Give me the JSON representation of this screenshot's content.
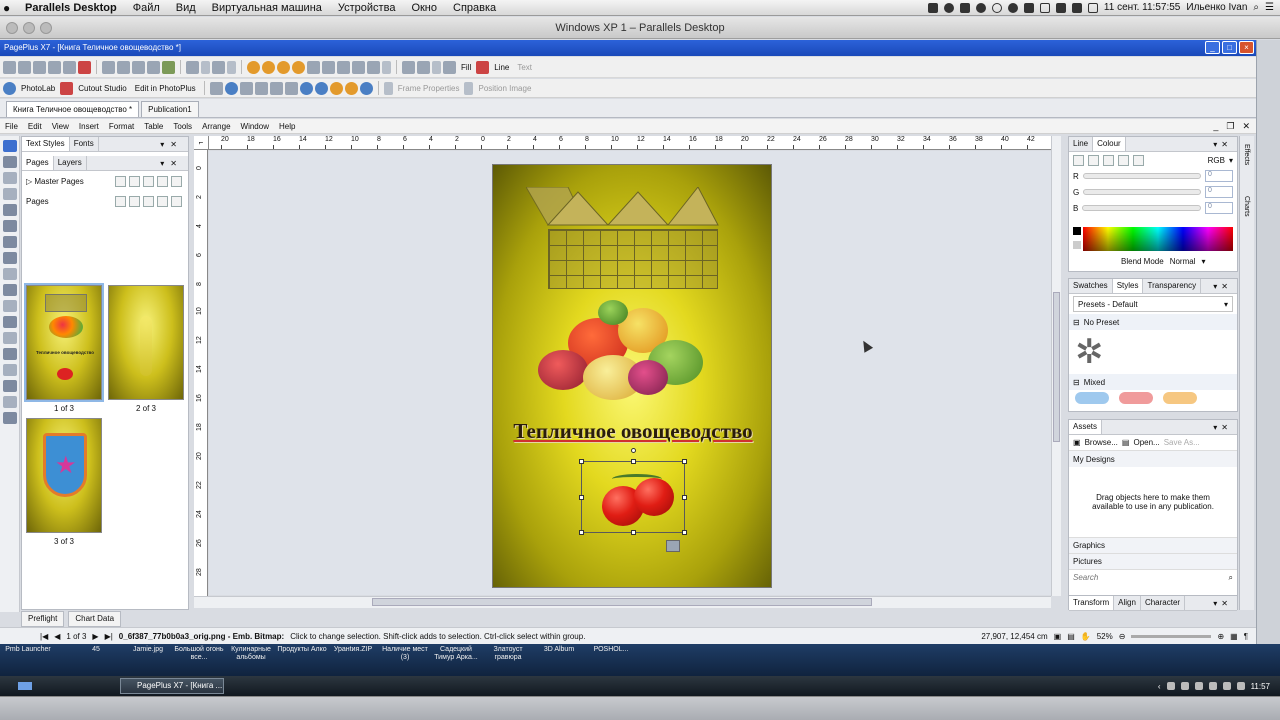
{
  "mac_menu": {
    "app": "Parallels Desktop",
    "items": [
      "Файл",
      "Вид",
      "Виртуальная машина",
      "Устройства",
      "Окно",
      "Справка"
    ],
    "clock": "11 сент.  11:57:55",
    "user": "Ильенко Ivan"
  },
  "parallels": {
    "title": "Windows XP 1 – Parallels Desktop"
  },
  "xp_window": {
    "title": "PagePlus X7 - [Книга Теличное овощеводство *]"
  },
  "toolbar2": {
    "photolab": "PhotoLab",
    "cutout": "Cutout Studio",
    "edit_photoplus": "Edit in PhotoPlus",
    "frame_properties": "Frame Properties",
    "position_image": "Position Image"
  },
  "toolbar1": {
    "fill": "Fill",
    "line": "Line",
    "text": "Text"
  },
  "doc_tabs": [
    "Книга Теличное овощеводство *",
    "Publication1"
  ],
  "menu": [
    "File",
    "Edit",
    "View",
    "Insert",
    "Format",
    "Table",
    "Tools",
    "Arrange",
    "Window",
    "Help"
  ],
  "left_panel": {
    "tabs_top": [
      "Text Styles",
      "Fonts"
    ],
    "tabs": [
      "Pages",
      "Layers"
    ],
    "master_pages": "Master Pages",
    "pages": "Pages",
    "thumbs": [
      {
        "label": "1 of 3",
        "title": "Тепличное овощеводство"
      },
      {
        "label": "2 of 3"
      },
      {
        "label": "3 of 3"
      }
    ],
    "bottom_tabs": [
      "Preflight",
      "Chart Data"
    ]
  },
  "ruler_h": [
    "20",
    "18",
    "16",
    "14",
    "12",
    "10",
    "8",
    "6",
    "4",
    "2",
    "0",
    "2",
    "4",
    "6",
    "8",
    "10",
    "12",
    "14",
    "16",
    "18",
    "20",
    "22",
    "24",
    "26",
    "28",
    "30",
    "32",
    "34",
    "36",
    "38",
    "40",
    "42"
  ],
  "ruler_v": [
    "0",
    "2",
    "4",
    "6",
    "8",
    "10",
    "12",
    "14",
    "16",
    "18",
    "20",
    "22",
    "24",
    "26",
    "28"
  ],
  "page_content": {
    "title": "Тепличное овощеводство"
  },
  "colour_panel": {
    "tabs": [
      "Line",
      "Colour"
    ],
    "model": "RGB",
    "r": "R",
    "g": "G",
    "b": "B",
    "r_value": "0",
    "g_value": "0",
    "b_value": "0",
    "blend_label": "Blend Mode",
    "blend_value": "Normal"
  },
  "styles_panel": {
    "tabs": [
      "Swatches",
      "Styles",
      "Transparency"
    ],
    "preset": "Presets - Default",
    "no_preset": "No Preset",
    "mixed": "Mixed"
  },
  "assets_panel": {
    "title": "Assets",
    "browse": "Browse...",
    "open": "Open...",
    "save_as": "Save As...",
    "my_designs": "My Designs",
    "hint": "Drag objects here to make them available to use in any publication.",
    "graphics": "Graphics",
    "pictures": "Pictures",
    "search_placeholder": "Search"
  },
  "transform_panel": {
    "tabs": [
      "Transform",
      "Align",
      "Character"
    ]
  },
  "side_tabs": [
    "Effects",
    "Charts"
  ],
  "status": {
    "page": "1 of 3",
    "message_file": "0_6f387_77b0b0a3_orig.png - Emb. Bitmap:",
    "message_rest": "Click to change selection. Shift-click adds to selection. Ctrl-click select within group.",
    "coords": "27,907, 12,454 cm",
    "zoom": "52%"
  },
  "desktop_icons": [
    "Pmb Launcher",
    "45",
    "Jamie.jpg",
    "Большой огонь все...",
    "Кулинарные альбомы",
    "Продукты Алко",
    "Уранtия.ZIP",
    "Наличие мест (3)",
    "Садецкий Тимур Арка...",
    "Златоуст гравюра",
    "3D Album",
    "РОSHOL..."
  ],
  "taskbar": {
    "item": "PagePlus X7 - [Книга ...",
    "clock": "11:57"
  }
}
